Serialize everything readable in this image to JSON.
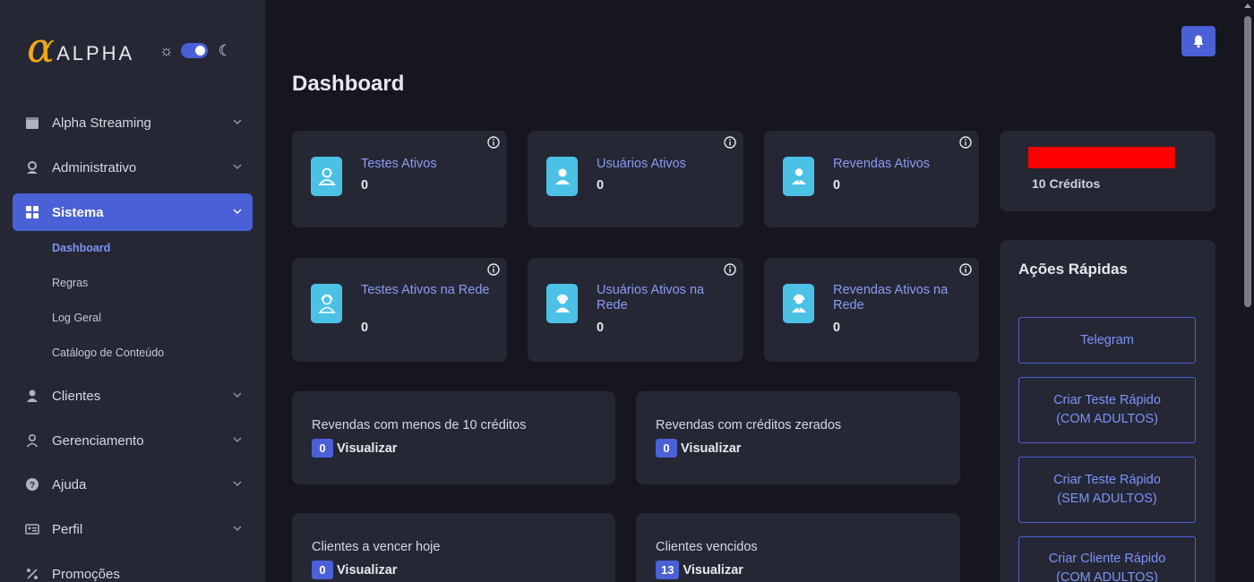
{
  "brand": {
    "alpha_glyph": "α",
    "text": "ALPHA"
  },
  "theme_toggle": {
    "on": true
  },
  "sidebar": {
    "items": [
      {
        "label": "Alpha Streaming",
        "icon": "clapperboard-icon"
      },
      {
        "label": "Administrativo",
        "icon": "admin-user-icon"
      },
      {
        "label": "Sistema",
        "icon": "grid-icon",
        "active": true
      },
      {
        "label": "Clientes",
        "icon": "user-icon"
      },
      {
        "label": "Gerenciamento",
        "icon": "user-outline-icon"
      },
      {
        "label": "Ajuda",
        "icon": "question-icon"
      },
      {
        "label": "Perfil",
        "icon": "id-card-icon"
      },
      {
        "label": "Promoções",
        "icon": "percent-icon"
      }
    ],
    "subitems": [
      {
        "label": "Dashboard",
        "active": true
      },
      {
        "label": "Regras"
      },
      {
        "label": "Log Geral"
      },
      {
        "label": "Catálogo de Conteúdo"
      }
    ]
  },
  "page": {
    "title": "Dashboard"
  },
  "stats": [
    {
      "label": "Testes Ativos",
      "value": "0"
    },
    {
      "label": "Usuários Ativos",
      "value": "0"
    },
    {
      "label": "Revendas Ativos",
      "value": "0"
    },
    {
      "label": "Testes Ativos na Rede",
      "value": "0"
    },
    {
      "label": "Usuários Ativos na Rede",
      "value": "0"
    },
    {
      "label": "Revendas Ativos na Rede",
      "value": "0"
    }
  ],
  "credits": {
    "text": "10 Créditos"
  },
  "alerts": [
    {
      "label": "Revendas com menos de 10 créditos",
      "count": "0",
      "action": "Visualizar"
    },
    {
      "label": "Revendas com créditos zerados",
      "count": "0",
      "action": "Visualizar"
    },
    {
      "label": "Clientes a vencer hoje",
      "count": "0",
      "action": "Visualizar"
    },
    {
      "label": "Clientes vencidos",
      "count": "13",
      "action": "Visualizar"
    }
  ],
  "quick_actions": {
    "title": "Ações Rápidas",
    "buttons": [
      {
        "line1": "Telegram",
        "line2": ""
      },
      {
        "line1": "Criar Teste Rápido",
        "line2": "(COM ADULTOS)"
      },
      {
        "line1": "Criar Teste Rápido",
        "line2": "(SEM ADULTOS)"
      },
      {
        "line1": "Criar Cliente Rápido",
        "line2": "(COM ADULTOS)"
      }
    ]
  },
  "colors": {
    "accent": "#4a60d6",
    "card": "#252735",
    "background": "#16161f",
    "avatar": "#4cc1e6",
    "brand": "#f0a814"
  }
}
